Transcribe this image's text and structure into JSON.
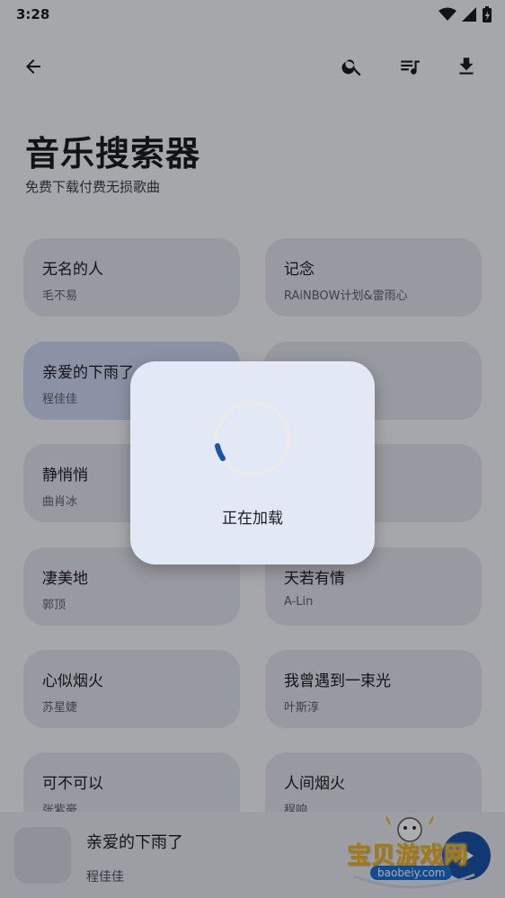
{
  "status_bar": {
    "time": "3:28"
  },
  "header": {
    "title": "音乐搜索器",
    "subtitle": "免费下载付费无损歌曲"
  },
  "songs": [
    {
      "title": "无名的人",
      "artist": "毛不易"
    },
    {
      "title": "记念",
      "artist": "RAiNBOW计划&雷雨心"
    },
    {
      "title": "亲爱的下雨了",
      "artist": "程佳佳"
    },
    {
      "title": "",
      "artist": ""
    },
    {
      "title": "静悄悄",
      "artist": "曲肖冰"
    },
    {
      "title": "",
      "artist": ""
    },
    {
      "title": "凄美地",
      "artist": "郭顶"
    },
    {
      "title": "天若有情",
      "artist": "A-Lin"
    },
    {
      "title": "心似烟火",
      "artist": "苏星婕"
    },
    {
      "title": "我曾遇到一束光",
      "artist": "叶斯淳"
    },
    {
      "title": "可不可以",
      "artist": "张紫豪"
    },
    {
      "title": "人间烟火",
      "artist": "程响"
    }
  ],
  "player": {
    "title": "亲爱的下雨了",
    "artist": "程佳佳"
  },
  "loading_dialog": {
    "message": "正在加载"
  },
  "watermark": {
    "text": "宝贝游戏网",
    "domain": "baobeiy.com"
  },
  "colors": {
    "accent": "#1a53a8",
    "card": "#e0e4ee",
    "selected_card": "#cfd7f4",
    "dialog": "#e3e8f6"
  }
}
